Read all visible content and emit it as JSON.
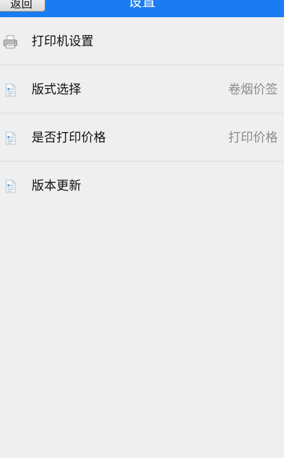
{
  "header": {
    "back_label": "返回",
    "title": "设置"
  },
  "settings": {
    "items": [
      {
        "icon": "printer-icon",
        "label": "打印机设置",
        "value": ""
      },
      {
        "icon": "document-icon",
        "label": "版式选择",
        "value": "卷烟价签"
      },
      {
        "icon": "document-icon",
        "label": "是否打印价格",
        "value": "打印价格"
      },
      {
        "icon": "document-icon",
        "label": "版本更新",
        "value": ""
      }
    ]
  },
  "colors": {
    "header_background": "#1a7bf2",
    "page_background": "#efefef",
    "value_text": "#8b8b8b"
  }
}
